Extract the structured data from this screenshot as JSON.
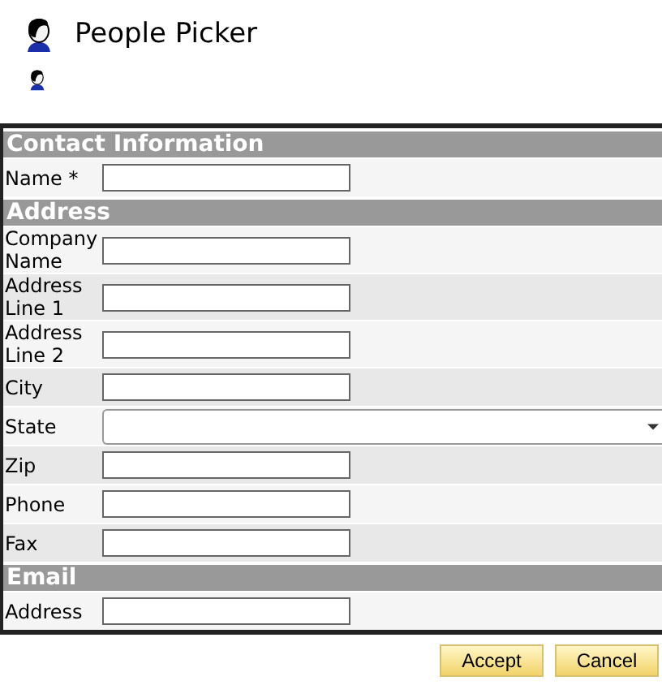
{
  "header": {
    "title": "People Picker"
  },
  "sections": [
    {
      "title": "Contact Information",
      "fields": [
        {
          "label": "Name  *",
          "kind": "text"
        }
      ]
    },
    {
      "title": "Address",
      "fields": [
        {
          "label": "Company Name",
          "kind": "text"
        },
        {
          "label": "Address Line 1",
          "kind": "text"
        },
        {
          "label": "Address Line 2",
          "kind": "text"
        },
        {
          "label": "City",
          "kind": "text"
        },
        {
          "label": "State",
          "kind": "select"
        },
        {
          "label": "Zip",
          "kind": "text"
        },
        {
          "label": "Phone",
          "kind": "text"
        },
        {
          "label": "Fax",
          "kind": "text"
        }
      ]
    },
    {
      "title": "Email",
      "fields": [
        {
          "label": "Address",
          "kind": "text"
        }
      ]
    }
  ],
  "buttons": [
    "Accept",
    "Cancel"
  ]
}
